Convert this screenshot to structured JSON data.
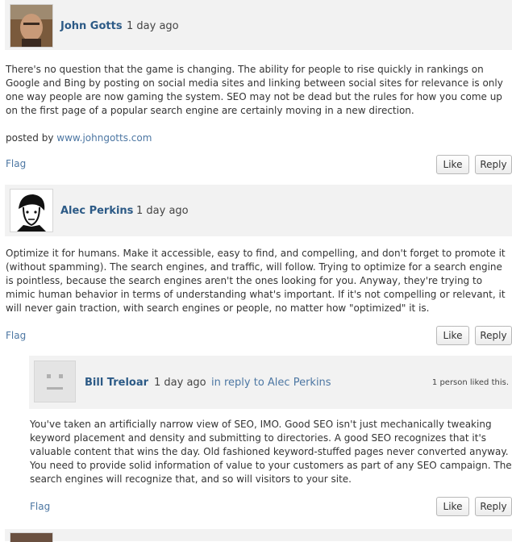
{
  "comments": [
    {
      "author": "John Gotts",
      "time": "1 day ago",
      "body": "There's no question that the game is changing. The ability for people to rise quickly in rankings on Google and Bing by posting on social media sites and linking between social sites for relevance is only one way people are now gaming the system. SEO may not be dead but the rules for how you come up on the first page of a popular search engine are certainly moving in a new direction.",
      "posted_by_label": "posted by",
      "posted_by_link": "www.johngotts.com",
      "flag": "Flag",
      "like": "Like",
      "reply": "Reply"
    },
    {
      "author": "Alec Perkins",
      "time": "1 day ago",
      "body": "Optimize it for humans. Make it accessible, easy to find, and compelling, and don't forget to promote it (without spamming). The search engines, and traffic, will follow. Trying to optimize for a search engine is pointless, because the search engines aren't the ones looking for you. Anyway, they're trying to mimic human behavior in terms of understanding what's important. If it's not compelling or relevant, it will never gain traction, with search engines or people, no matter how \"optimized\" it is.",
      "flag": "Flag",
      "like": "Like",
      "reply": "Reply"
    },
    {
      "author": "Bill Treloar",
      "time": "1 day ago",
      "in_reply_to": "in reply to Alec Perkins",
      "likes": "1 person liked this.",
      "body": "You've taken an artificially narrow view of SEO, IMO. Good SEO isn't just mechanically tweaking keyword placement and density and submitting to directories. A good SEO recognizes that it's valuable content that wins the day. Old fashioned keyword-stuffed pages never converted anyway. You need to provide solid information of value to your customers as part of any SEO campaign. The search engines will recognize that, and so will visitors to your site.",
      "flag": "Flag",
      "like": "Like",
      "reply": "Reply"
    }
  ],
  "colors": {
    "link": "#4d77a3",
    "author": "#2c5a86",
    "header_bg": "#f2f2f2"
  }
}
